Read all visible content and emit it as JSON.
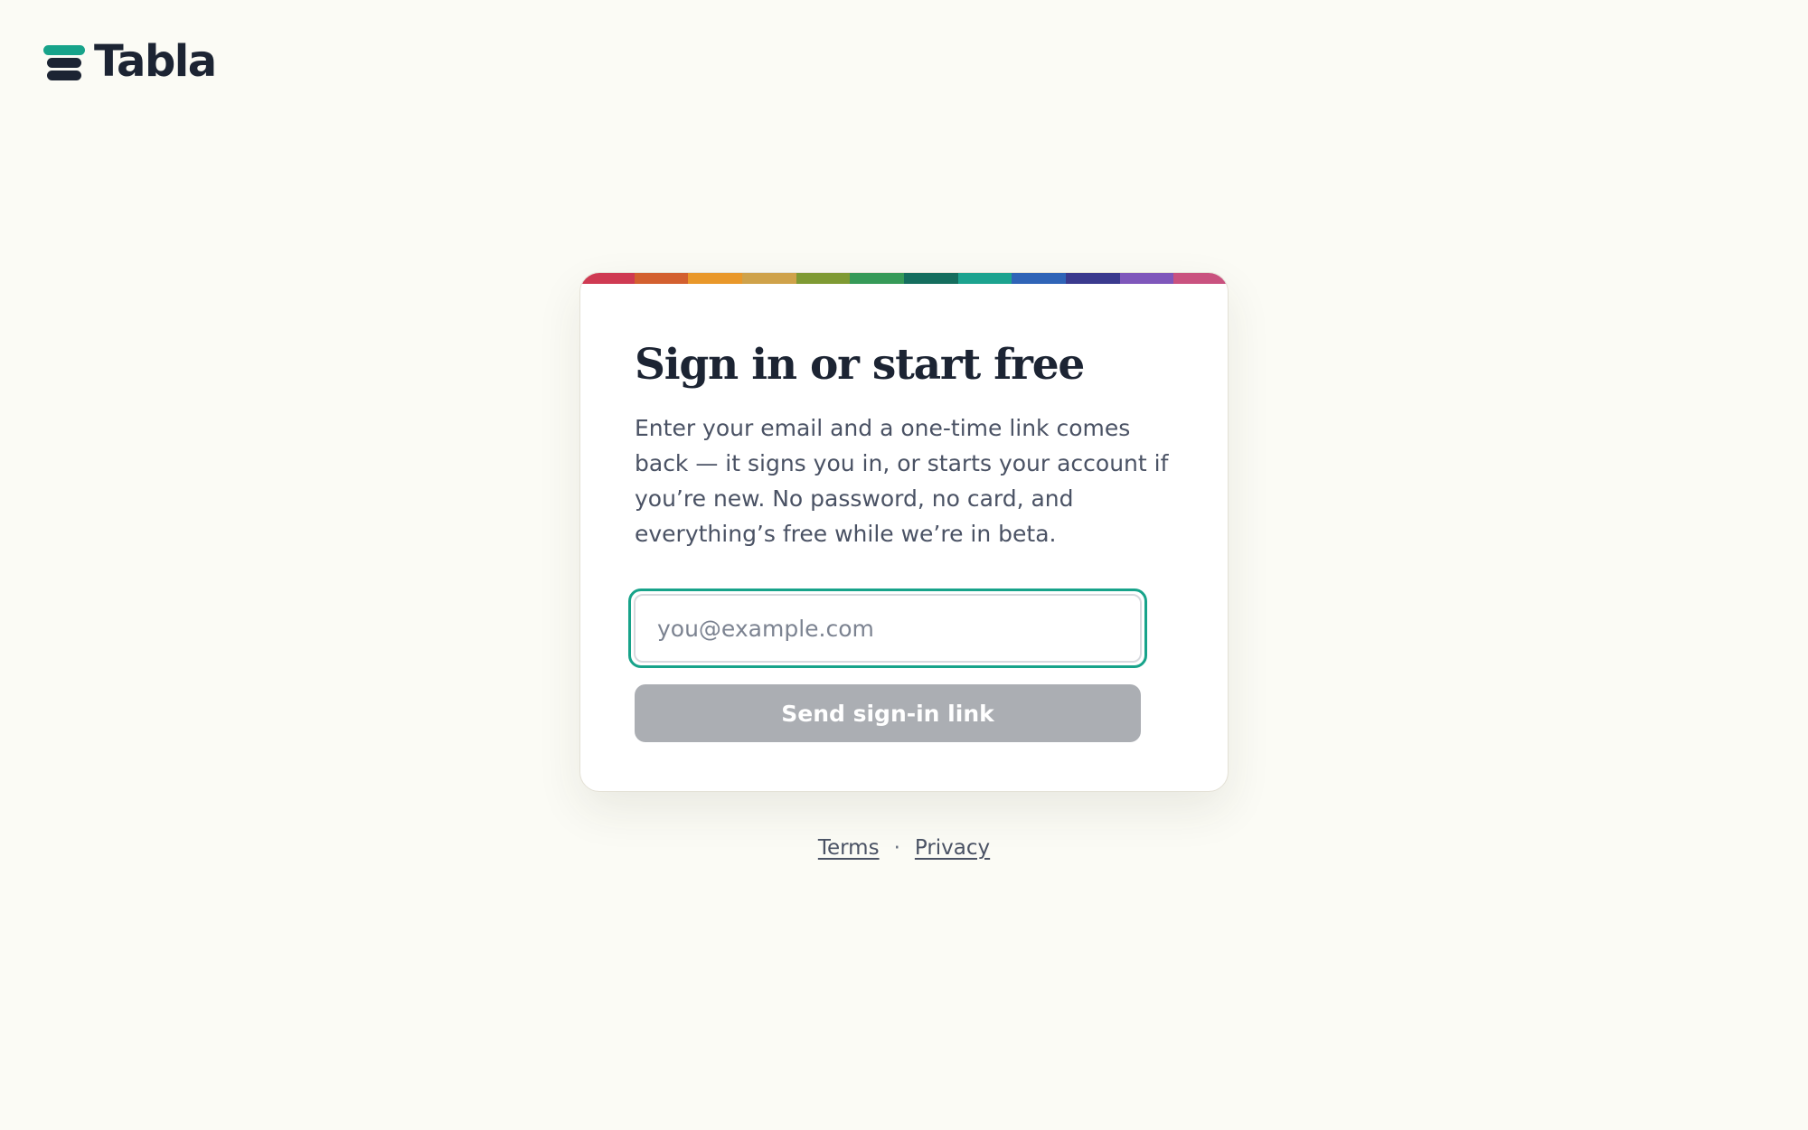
{
  "brand": {
    "name": "Tabla",
    "accent_color": "#17a38a",
    "dark_color": "#1c2433"
  },
  "signin_card": {
    "title": "Sign in or start free",
    "description": "Enter your email and a one-time link comes back — it signs you in, or starts your account if you’re new. No password, no card, and everything’s free while we’re in beta.",
    "email_input": {
      "value": "",
      "placeholder": "you@example.com"
    },
    "submit_label": "Send sign-in link",
    "submit_state": "disabled",
    "stripe_colors": [
      "#cf3a52",
      "#d3602f",
      "#e9982a",
      "#cfa24a",
      "#7f9a33",
      "#369a58",
      "#156e5e",
      "#1ca38f",
      "#2f64b7",
      "#3b3a8e",
      "#7f57bb",
      "#c9527f"
    ]
  },
  "footer": {
    "terms_label": "Terms",
    "separator": "·",
    "privacy_label": "Privacy"
  }
}
